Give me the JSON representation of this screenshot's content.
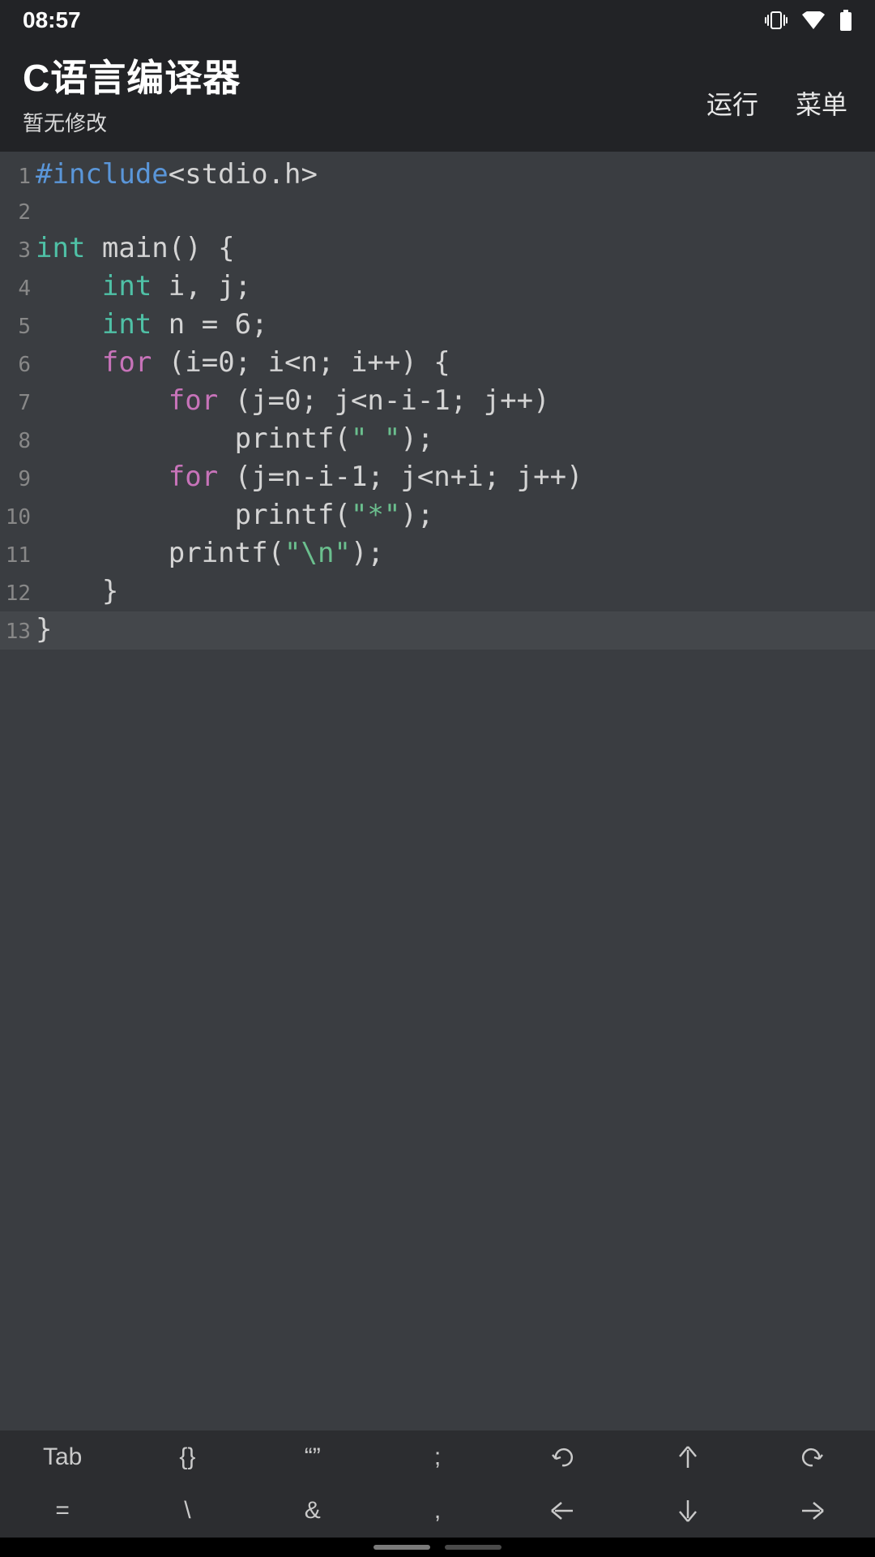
{
  "status": {
    "time": "08:57"
  },
  "header": {
    "title": "C语言编译器",
    "subtitle": "暂无修改",
    "run": "运行",
    "menu": "菜单"
  },
  "code": {
    "lines": [
      {
        "n": "1",
        "tokens": [
          {
            "cls": "kw-blue",
            "t": "#include"
          },
          {
            "cls": "tok",
            "t": "<stdio.h>"
          }
        ]
      },
      {
        "n": "2",
        "tokens": []
      },
      {
        "n": "3",
        "tokens": [
          {
            "cls": "kw-teal",
            "t": "int"
          },
          {
            "cls": "tok",
            "t": " main() {"
          }
        ]
      },
      {
        "n": "4",
        "tokens": [
          {
            "cls": "tok",
            "t": "    "
          },
          {
            "cls": "kw-teal",
            "t": "int"
          },
          {
            "cls": "tok",
            "t": " i, j;"
          }
        ]
      },
      {
        "n": "5",
        "tokens": [
          {
            "cls": "tok",
            "t": "    "
          },
          {
            "cls": "kw-teal",
            "t": "int"
          },
          {
            "cls": "tok",
            "t": " n = 6;"
          }
        ]
      },
      {
        "n": "6",
        "tokens": [
          {
            "cls": "tok",
            "t": "    "
          },
          {
            "cls": "kw-mag",
            "t": "for"
          },
          {
            "cls": "tok",
            "t": " (i=0; i<n; i++) {"
          }
        ]
      },
      {
        "n": "7",
        "tokens": [
          {
            "cls": "tok",
            "t": "        "
          },
          {
            "cls": "kw-mag",
            "t": "for"
          },
          {
            "cls": "tok",
            "t": " (j=0; j<n-i-1; j++)"
          }
        ]
      },
      {
        "n": "8",
        "tokens": [
          {
            "cls": "tok",
            "t": "            printf("
          },
          {
            "cls": "str",
            "t": "\" \""
          },
          {
            "cls": "tok",
            "t": ");"
          }
        ]
      },
      {
        "n": "9",
        "tokens": [
          {
            "cls": "tok",
            "t": "        "
          },
          {
            "cls": "kw-mag",
            "t": "for"
          },
          {
            "cls": "tok",
            "t": " (j=n-i-1; j<n+i; j++)"
          }
        ]
      },
      {
        "n": "10",
        "tokens": [
          {
            "cls": "tok",
            "t": "            printf("
          },
          {
            "cls": "str",
            "t": "\"*\""
          },
          {
            "cls": "tok",
            "t": ");"
          }
        ]
      },
      {
        "n": "11",
        "tokens": [
          {
            "cls": "tok",
            "t": "        printf("
          },
          {
            "cls": "str",
            "t": "\"\\n\""
          },
          {
            "cls": "tok",
            "t": ");"
          }
        ]
      },
      {
        "n": "12",
        "tokens": [
          {
            "cls": "tok",
            "t": "    }"
          }
        ]
      },
      {
        "n": "13",
        "tokens": [
          {
            "cls": "tok",
            "t": "}"
          }
        ],
        "current": true
      }
    ]
  },
  "toolbar": {
    "row1": [
      "Tab",
      "{}",
      "“”",
      ";",
      "undo-icon",
      "up-icon",
      "redo-icon"
    ],
    "row2": [
      "=",
      "\\",
      "&",
      ",",
      "left-icon",
      "down-icon",
      "right-icon"
    ]
  }
}
